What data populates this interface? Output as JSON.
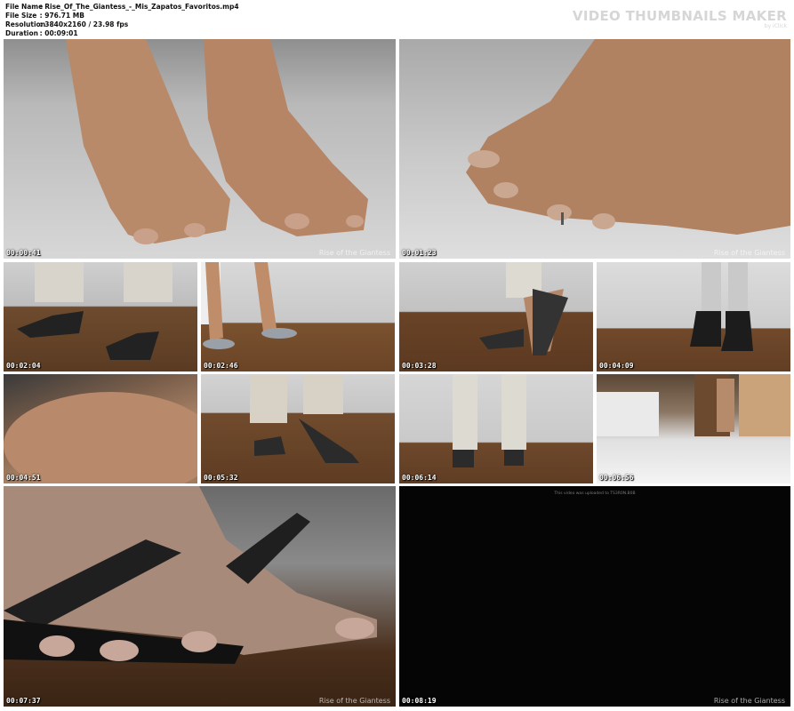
{
  "file_info": {
    "file_name_label": "File Name",
    "file_name_value": "Rise_Of_The_Giantess_-_Mis_Zapatos_Favoritos.mp4",
    "file_size_label": "File Size",
    "file_size_value": "976.71 MB",
    "resolution_label": "Resolution",
    "resolution_value": "3840x2160 / 23.98 fps",
    "duration_label": "Duration",
    "duration_value": "00:09:01",
    "separator": ":"
  },
  "brand": {
    "title": "VIDEO THUMBNAILS MAKER",
    "subtitle": "by iClick"
  },
  "watermark": "Rise of the Giantess",
  "end_message": "This video was uploaded to TS3R0N.B0B",
  "thumbnails": [
    {
      "time": "00:00:41"
    },
    {
      "time": "00:01:23"
    },
    {
      "time": "00:02:04"
    },
    {
      "time": "00:02:46"
    },
    {
      "time": "00:03:28"
    },
    {
      "time": "00:04:09"
    },
    {
      "time": "00:04:51"
    },
    {
      "time": "00:05:32"
    },
    {
      "time": "00:06:14"
    },
    {
      "time": "00:06:56"
    },
    {
      "time": "00:07:37"
    },
    {
      "time": "00:08:19"
    }
  ]
}
